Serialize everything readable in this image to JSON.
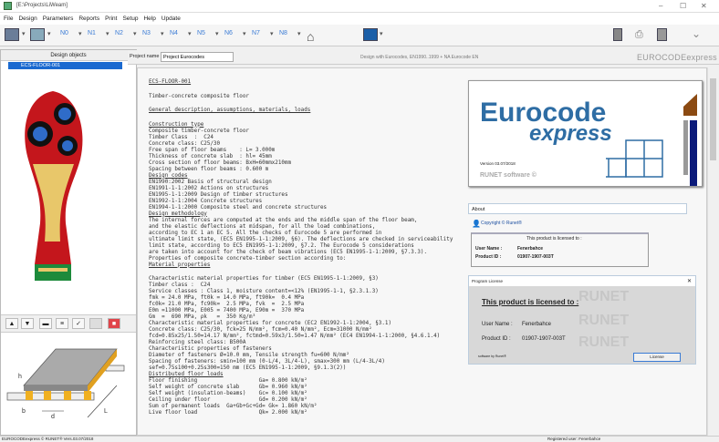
{
  "window": {
    "title": "[E:\\Projects\\LiWeam]",
    "min": "–",
    "max": "☐",
    "close": "✕"
  },
  "menu": [
    "File",
    "Design",
    "Parameters",
    "Reports",
    "Print",
    "Setup",
    "Help",
    "Update"
  ],
  "toolbar": {
    "nodes": [
      "N0",
      "N1",
      "N2",
      "N3",
      "N4",
      "N5",
      "N6",
      "N7",
      "N8"
    ],
    "dropdown": "▾"
  },
  "left": {
    "header": "Design objects",
    "tree_item": "ECS-FLOOR-001",
    "diagram_labels": {
      "h": "h",
      "b": "b",
      "d": "d",
      "L": "L"
    }
  },
  "project": {
    "label": "Project name",
    "value": "Project Eurocodes",
    "subtitle": "Design with Eurocodes, EN1990..1999 + NA Eurocode EN",
    "brand": "EUROCODEexpress"
  },
  "report": [
    {
      "t": "ECS-FLOOR-001",
      "u": true
    },
    {
      "gap": true
    },
    {
      "t": "Timber-concrete composite floor"
    },
    {
      "gap": true
    },
    {
      "t": "General description, assumptions, materials, loads",
      "u": true
    },
    {
      "gap": true
    },
    {
      "t": "Construction type",
      "u": true
    },
    {
      "t": "Composite timber-concrete floor"
    },
    {
      "t": "Timber Class  :  C24"
    },
    {
      "t": "Concrete class: C25/30"
    },
    {
      "t": "Free span of floor beams    : L= 3.000m"
    },
    {
      "t": "Thickness of concrete slab  : hl= 45mm"
    },
    {
      "t": "Cross section of floor beams: BxH=60mmx210mm"
    },
    {
      "t": "Spacing between floor beams : 0.600 m"
    },
    {
      "t": "Design codes",
      "u": true
    },
    {
      "t": "EN1990:2002 Basis of structural design"
    },
    {
      "t": "EN1991-1-1:2002 Actions on structures"
    },
    {
      "t": "EN1995-1-1:2009 Design of timber structures"
    },
    {
      "t": "EN1992-1-1:2004 Concrete structures"
    },
    {
      "t": "EN1994-1-1:2000 Composite steel and concrete structures"
    },
    {
      "t": "Design methodology",
      "u": true
    },
    {
      "t": "The internal forces are computed at the ends and the middle span of the floor beam,"
    },
    {
      "t": "and the elastic deflections at midspan, for all the load combinations,"
    },
    {
      "t": "according to EC 1 an EC 5. All the checks of Eurocode 5 are performed in"
    },
    {
      "t": "ultimate limit state, (EC5 EN1995-1-1:2009, §6). The deflections are checked in serviceability"
    },
    {
      "t": "limit state, according to EC5 EN1995-1-1:2009, §7.2. The Eurocode 5 considerations"
    },
    {
      "t": "are taken into account for the check of beam vibrations (EC5 EN1995-1-1:2009, §7.3.3)."
    },
    {
      "t": "Properties of composite concrete-timber section according to:"
    },
    {
      "t": "Material properties",
      "u": true
    },
    {
      "gap": true
    },
    {
      "t": "Characteristic material properties for timber (EC5 EN1995-1-1:2009, §3)"
    },
    {
      "t": "Timber class :  C24"
    },
    {
      "t": "Service classes : Class 1, moisture content=<12% (EN1995-1-1, §2.3.1.3)"
    },
    {
      "t": "fmk = 24.0 MPa, ft0k = 14.0 MPa, ft90k=  0.4 MPa"
    },
    {
      "t": "fc0k= 21.0 MPa, fc90k=  2.5 MPa, fvk  =  2.5 MPa"
    },
    {
      "t": "E0m =11000 MPa, E005 = 7400 MPa, E90m =  370 MPa"
    },
    {
      "t": "Gm  =  690 MPa, ρk   =  350 Kg/m³"
    },
    {
      "t": "Characteristic material properties for concrete (EC2 EN1992-1-1:2004, §3.1)"
    },
    {
      "t": "Concrete class: C25/30, fck=25 N/mm², fcm=0.40 N/mm², Ecm=31000 N/mm²"
    },
    {
      "t": "fcd=0.85x25/1.50=14.17 N/mm², fctmd=0.59x3/1.50=1.47 N/mm² (EC4 EN1994-1-1:2000, §4.6.1.4)"
    },
    {
      "t": "Reinforcing steel class: B500A"
    },
    {
      "t": "Characteristic properties of fasteners"
    },
    {
      "t": "Diameter of fasteners Ø=10.0 mm, Tensile strength fu=600 N/mm²"
    },
    {
      "t": "Spacing of fasteners: smin=100 mm (0-L/4, 3L/4-L), smax=300 mm (L/4-3L/4)"
    },
    {
      "t": "sef=0.75s100+0.25s300=150 mm (EC5 EN1995-1-1:2009, §9.1.3(2))"
    },
    {
      "t": "Distributed floor loads",
      "u": true
    },
    {
      "t": "Floor finishing                   Ga= 0.800 kN/m²"
    },
    {
      "t": "Self weight of concrete slab      Gb= 0.960 kN/m²"
    },
    {
      "t": "Self weight (insulation-beams)    Gc= 0.100 kN/m²"
    },
    {
      "t": "Ceiling under floor               Gd= 0.200 kN/m²"
    },
    {
      "t": "Sum of permanent loads  Ga+Gb+Gc+Gd= Gk= 1.860 kN/m²"
    },
    {
      "t": "Live floor load                   Qk= 2.000 kN/m²"
    }
  ],
  "splash": {
    "line1": "Eurocode",
    "line2": "express",
    "version": "Version 03.07/2018",
    "company": "RUNET software ©"
  },
  "about": {
    "header": "About",
    "copyright": "Copyright © Runet®",
    "licensed_to": "This product is licensed to :",
    "user_label": "User Name :",
    "user": "Fenerbahce",
    "pid_label": "Product ID :",
    "pid": "01907-1907-003T"
  },
  "license": {
    "header": "Program License",
    "close": "✕",
    "title": "This product is licensed to :",
    "user_label": "User Name :",
    "user": "Fenerbahce",
    "pid_label": "Product ID :",
    "pid": "01907-1907-003T",
    "software": "software by Runet®",
    "button": "License",
    "watermark": "RUNET"
  },
  "status": {
    "left": "EUROCODEexpress © RUNET®  Vers.03.07/2018",
    "right": "Registered user: Fenerbahce"
  },
  "colors": {
    "selection": "#1b6ad0",
    "brand_blue": "#2e6da4",
    "toolbar_blue": "#3a7bd5"
  }
}
